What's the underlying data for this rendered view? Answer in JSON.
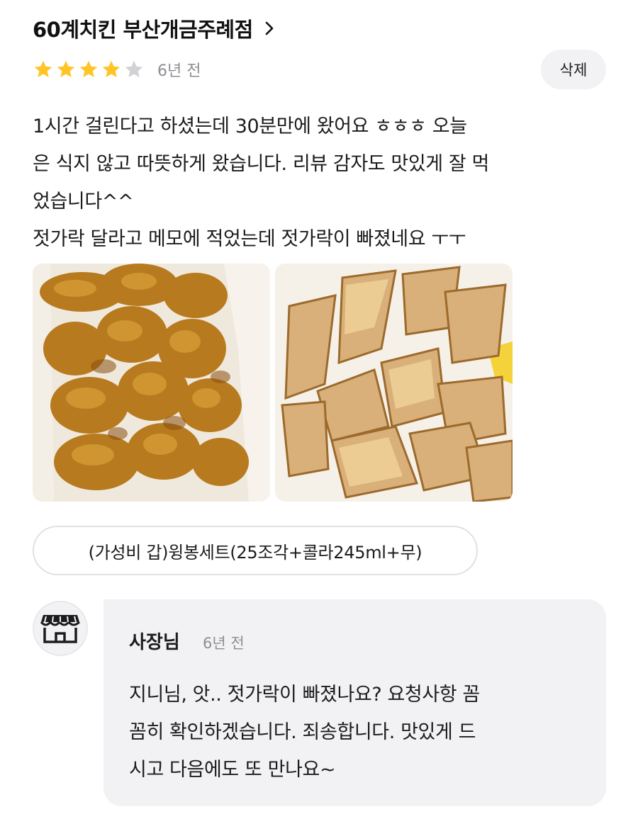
{
  "store": {
    "name": "60계치킨 부산개금주례점",
    "chevron_icon": "chevron-right-icon"
  },
  "review": {
    "rating": 4,
    "max_rating": 5,
    "star_filled_color": "#FFC527",
    "star_empty_color": "#D1D1D6",
    "time_ago": "6년 전",
    "delete_label": "삭제",
    "text_lines": [
      "1시간 걸린다고 하셨는데 30분만에 왔어요 ㅎㅎㅎ 오늘",
      "은 식지 않고 따뜻하게 왔습니다. 리뷰 감자도 맛있게 잘 먹",
      "었습니다^^",
      "젓가락 달라고 메모에 적었는데 젓가락이 빠졌네요 ㅜㅜ"
    ],
    "photos": [
      "fried-chicken-photo",
      "potato-wedges-photo"
    ],
    "menu_item": "(가성비 갑)윙봉세트(25조각+콜라245ml+무)"
  },
  "owner_reply": {
    "avatar_icon": "storefront-icon",
    "name": "사장님",
    "time_ago": "6년 전",
    "text_lines": [
      "지니님, 앗.. 젓가락이 빠졌나요? 요청사항 꼼",
      "꼼히 확인하겠습니다. 죄송합니다. 맛있게 드",
      "시고 다음에도 또 만나요~"
    ]
  }
}
